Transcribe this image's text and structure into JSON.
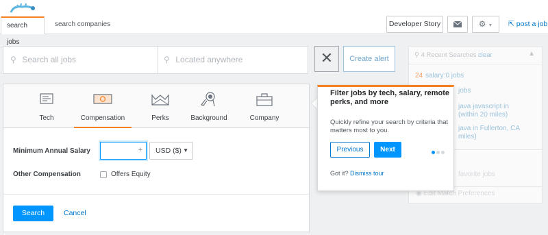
{
  "header": {
    "tabs": [
      {
        "label": "search jobs",
        "active": true
      },
      {
        "label": "search companies",
        "active": false
      }
    ],
    "developer_story": "Developer Story",
    "mail_icon": "mail-icon",
    "gear_icon": "gear-icon",
    "post_job": "post a job",
    "accent": "#f48024"
  },
  "search": {
    "keywords_placeholder": "Search all jobs",
    "location_placeholder": "Located anywhere",
    "clear_icon": "close-icon",
    "create_alert": "Create alert"
  },
  "sidebar": {
    "recent_count_text": "4 Recent Searches",
    "clear": "clear",
    "recent_items": [
      {
        "count": "24",
        "label": "salary:0 jobs"
      },
      {
        "label": "jobs"
      },
      {
        "label": "java javascript in"
      },
      {
        "label": "(within 20 miles)"
      },
      {
        "label": "java in Fullerton, CA"
      },
      {
        "label": "miles)"
      }
    ],
    "favorites_text": "favorite jobs",
    "edit_prefs": "Edit Match Preferences"
  },
  "filters": {
    "categories": [
      {
        "label": "Tech",
        "icon": "tech-icon"
      },
      {
        "label": "Compensation",
        "icon": "compensation-icon",
        "active": true
      },
      {
        "label": "Perks",
        "icon": "perks-icon"
      },
      {
        "label": "Background",
        "icon": "background-icon"
      },
      {
        "label": "Company",
        "icon": "company-icon"
      }
    ],
    "min_salary_label": "Minimum Annual Salary",
    "min_salary_value": "",
    "currency": "USD ($)",
    "other_comp_label": "Other Compensation",
    "offers_equity": "Offers Equity",
    "offers_equity_checked": false,
    "search_button": "Search",
    "cancel_button": "Cancel"
  },
  "tour": {
    "title": "Filter jobs by tech, salary, remote perks, and more",
    "text": "Quickly refine your search by criteria that matters most to you.",
    "previous": "Previous",
    "next": "Next",
    "step": 1,
    "total_steps": 3,
    "footer_prefix": "Got it?",
    "dismiss": "Dismiss tour"
  }
}
